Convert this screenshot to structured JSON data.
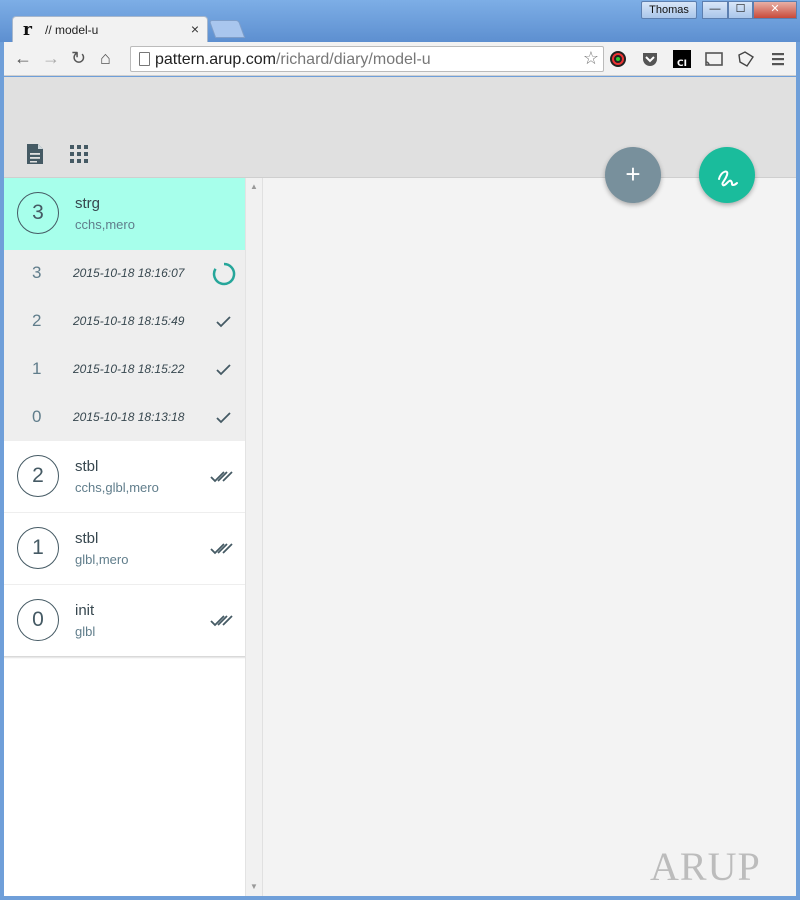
{
  "browser": {
    "tab_title": "// model-u",
    "tab_favicon": "r",
    "tab_close": "×",
    "user_name": "Thomas",
    "url_host": "pattern.arup.com",
    "url_path": "/richard/diary/model-u",
    "window_buttons": {
      "minimize": "—",
      "maximize": "☐",
      "close": "✕"
    },
    "extension_icons": [
      "color-picker-icon",
      "pocket-icon",
      "ci-icon",
      "cast-icon",
      "extension-icon",
      "menu-icon"
    ]
  },
  "app": {
    "toolbar_icons": [
      "document-icon",
      "grid-icon"
    ],
    "fab_add_label": "+",
    "fab_sign_icon": "signature-icon",
    "accent_color": "#1abc9c",
    "selected_color": "#a7ffeb",
    "watermark": "ARUP"
  },
  "sidebar": {
    "items": [
      {
        "number": "3",
        "title": "strg",
        "subtitle": "cchs,mero",
        "state": "active"
      },
      {
        "number": "2",
        "title": "stbl",
        "subtitle": "cchs,glbl,mero",
        "state": "done"
      },
      {
        "number": "1",
        "title": "stbl",
        "subtitle": "glbl,mero",
        "state": "done"
      },
      {
        "number": "0",
        "title": "init",
        "subtitle": "glbl",
        "state": "done"
      }
    ],
    "revisions": [
      {
        "number": "3",
        "time": "2015-10-18 18:16:07",
        "status": "loading"
      },
      {
        "number": "2",
        "time": "2015-10-18 18:15:49",
        "status": "check"
      },
      {
        "number": "1",
        "time": "2015-10-18 18:15:22",
        "status": "check"
      },
      {
        "number": "0",
        "time": "2015-10-18 18:13:18",
        "status": "check"
      }
    ]
  }
}
